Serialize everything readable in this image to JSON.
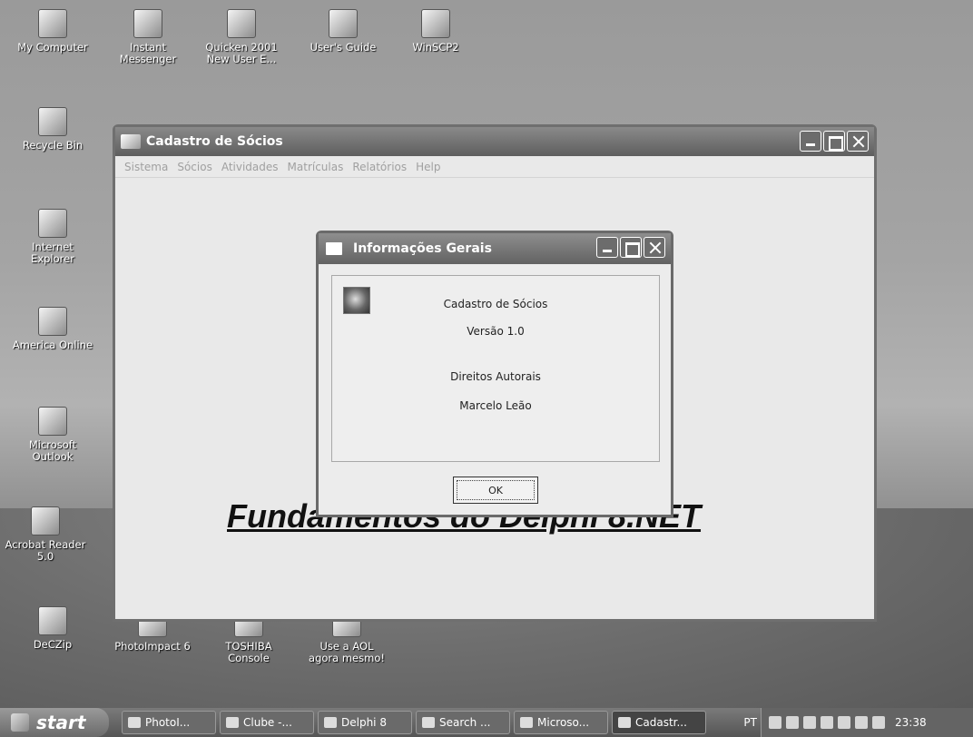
{
  "desktop": {
    "icons": [
      {
        "name": "my-computer",
        "label": "My Computer"
      },
      {
        "name": "instant-messenger",
        "label": "Instant\nMessenger"
      },
      {
        "name": "quicken-2001",
        "label": "Quicken 2001\nNew User E..."
      },
      {
        "name": "users-guide",
        "label": "User's Guide"
      },
      {
        "name": "winscp2",
        "label": "WinSCP2"
      },
      {
        "name": "recycle-bin",
        "label": "Recycle Bin"
      },
      {
        "name": "internet-explorer",
        "label": "Internet\nExplorer"
      },
      {
        "name": "america-online",
        "label": "America Online"
      },
      {
        "name": "microsoft-outlook",
        "label": "Microsoft\nOutlook"
      },
      {
        "name": "acrobat-reader",
        "label": "Acrobat Reader\n5.0"
      },
      {
        "name": "deczip",
        "label": "DeCZip"
      },
      {
        "name": "photoimpact-6",
        "label": "PhotoImpact 6"
      },
      {
        "name": "toshiba-console",
        "label": "TOSHIBA\nConsole"
      },
      {
        "name": "use-aol",
        "label": "Use a AOL\nagora mesmo!"
      }
    ]
  },
  "main_window": {
    "title": "Cadastro de Sócios",
    "menu": [
      "Sistema",
      "Sócios",
      "Atividades",
      "Matrículas",
      "Relatórios",
      "Help"
    ],
    "banner": "Fundamentos do Delphi 8.NET"
  },
  "dialog": {
    "title": "Informações Gerais",
    "lines": [
      "Cadastro de Sócios",
      "Versão 1.0",
      "Direitos Autorais",
      "Marcelo Leão"
    ],
    "ok_label": "OK"
  },
  "taskbar": {
    "start_label": "start",
    "tasks": [
      "PhotoI...",
      "Clube -...",
      "Delphi 8",
      "Search ...",
      "Microso...",
      "Cadastr..."
    ],
    "language": "PT",
    "clock": "23:38"
  }
}
